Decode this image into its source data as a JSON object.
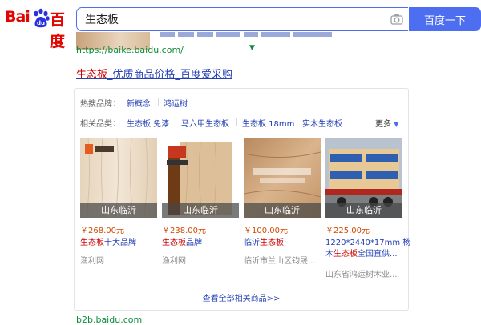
{
  "header": {
    "logo_bai": "Bai",
    "logo_du": "百度",
    "search_value": "生态板",
    "search_button": "百度一下"
  },
  "previous_result": {
    "url": "https://baike.baidu.com/"
  },
  "result": {
    "title_keyword": "生态板",
    "title_rest": "_优质商品价格_百度爱采购"
  },
  "card": {
    "hot_brands_label": "热搜品牌：",
    "hot_brands": [
      "新概念",
      "鸿运树"
    ],
    "related_label": "相关品类：",
    "related": [
      "生态板 免漆",
      "马六甲生态板",
      "生态板 18mm",
      "实木生态板"
    ],
    "more_label": "更多",
    "products": [
      {
        "location": "山东临沂",
        "price": "￥268.00元",
        "name_keyword": "生态板",
        "name_rest": "十大品牌",
        "shop": "渔利网"
      },
      {
        "location": "山东临沂",
        "price": "￥238.00元",
        "name_keyword": "生态板",
        "name_rest": "品牌",
        "shop": "渔利网"
      },
      {
        "location": "山东临沂",
        "price": "￥100.00元",
        "name_pre": "临沂",
        "name_keyword": "生态板",
        "shop": "临沂市兰山区钧晟..."
      },
      {
        "location": "山东临沂",
        "price": "￥225.00元",
        "name_line1": "1220*2440*17mm 杨",
        "name_pre": "木",
        "name_keyword": "生态板",
        "name_rest": "全国直供...",
        "shop": "山东省鸿运树木业..."
      }
    ],
    "view_all": "查看全部相关商品>>"
  },
  "next_result": {
    "url": "b2b.baidu.com"
  },
  "colors": {
    "accent": "#4e6ef2",
    "link": "#2440b3",
    "keyword": "#cc0000",
    "price": "#d04a02",
    "url_green": "#0e8a3a",
    "logo_red": "#e10601"
  },
  "icons": {
    "camera": "camera-icon",
    "paw": "baidu-paw-icon",
    "caret": "caret-down-icon"
  }
}
